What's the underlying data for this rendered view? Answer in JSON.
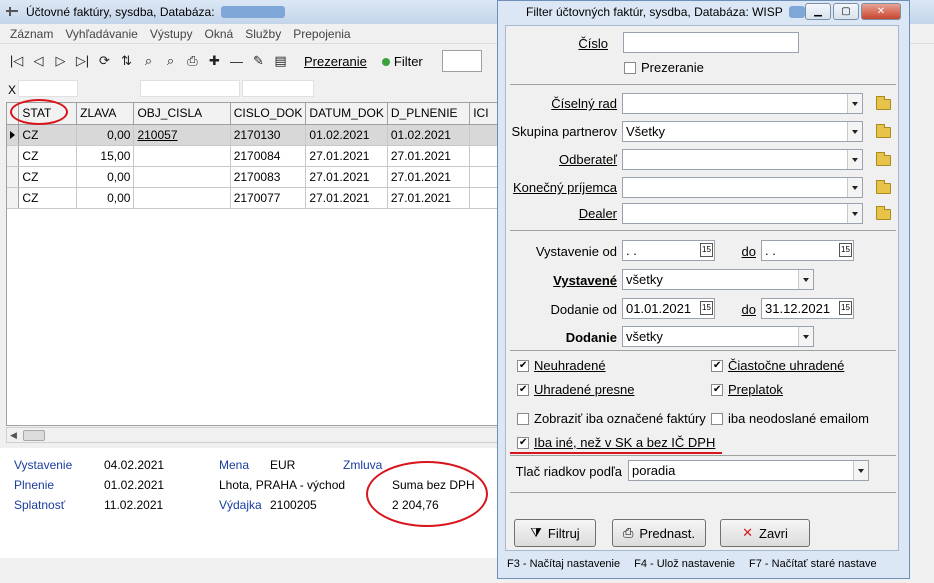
{
  "main": {
    "title_prefix": "Účtovné faktúry, sysdba, Databáza:",
    "menu": [
      "Záznam",
      "Vyhľadávanie",
      "Výstupy",
      "Okná",
      "Služby",
      "Prepojenia"
    ],
    "toolbar": {
      "prezeranie": "Prezeranie",
      "filter": "Filter"
    },
    "x_label": "X",
    "columns": [
      "STAT",
      "ZLAVA",
      "OBJ_CISLA",
      "CISLO_DOK",
      "DATUM_DOK",
      "D_PLNENIE",
      "ICI"
    ],
    "rows": [
      [
        "CZ",
        "0,00",
        "210057",
        "2170130",
        "01.02.2021",
        "01.02.2021",
        ""
      ],
      [
        "CZ",
        "15,00",
        "",
        "2170084",
        "27.01.2021",
        "27.01.2021",
        ""
      ],
      [
        "CZ",
        "0,00",
        "",
        "2170083",
        "27.01.2021",
        "27.01.2021",
        ""
      ],
      [
        "CZ",
        "0,00",
        "",
        "2170077",
        "27.01.2021",
        "27.01.2021",
        ""
      ]
    ],
    "detail": {
      "vystavenie_label": "Vystavenie",
      "vystavenie": "04.02.2021",
      "plnenie_label": "Plnenie",
      "plnenie": "01.02.2021",
      "splatnost_label": "Splatnosť",
      "splatnost": "11.02.2021",
      "mena_label": "Mena",
      "mena": "EUR",
      "zmluva_label": "Zmluva",
      "adresa": "Lhota, PRAHA - východ",
      "vydajka_label": "Výdajka",
      "vydajka": "2100205",
      "suma_label": "Suma bez DPH",
      "suma": "2 204,76"
    }
  },
  "dialog": {
    "title": "Filter účtovných faktúr, sysdba, Databáza: WISP",
    "cislo_label": "Číslo",
    "cislo_value": "",
    "prezeranie_label": "Prezeranie",
    "ciselny_rad_label": "Číselný rad",
    "skupina_label": "Skupina partnerov",
    "skupina_value": "Všetky",
    "odberatel_label": "Odberateľ",
    "konecny_label": "Konečný príjemca",
    "dealer_label": "Dealer",
    "vystavenie_od_label": "Vystavenie od",
    "vystavenie_od": " .  .",
    "do_label": "do",
    "vystavenie_do": " .  .",
    "vystavene_label": "Vystavené",
    "vystavene_value": "všetky",
    "dodanie_od_label": "Dodanie od",
    "dodanie_od": "01.01.2021",
    "dodanie_do": "31.12.2021",
    "dodanie_label": "Dodanie",
    "dodanie_value": "všetky",
    "neuhradene": "Neuhradené",
    "ciastocne": "Čiastočne uhradené",
    "uhradene_presne": "Uhradené presne",
    "preplatok": "Preplatok",
    "zobrazit_oznacene": "Zobraziť iba označené faktúry",
    "iba_neodoslane": "iba neodoslané emailom",
    "iba_ine": "Iba iné, než v SK a bez IČ DPH",
    "tlac_label": "Tlač riadkov podľa",
    "tlac_value": "poradia",
    "btn_filtruj": "Filtruj",
    "btn_prednast": "Prednast.",
    "btn_zavri": "Zavri",
    "status": [
      "F3 - Načítaj nastavenie",
      "F4 - Ulož nastavenie",
      "F7 - Načítať staré nastave"
    ]
  }
}
